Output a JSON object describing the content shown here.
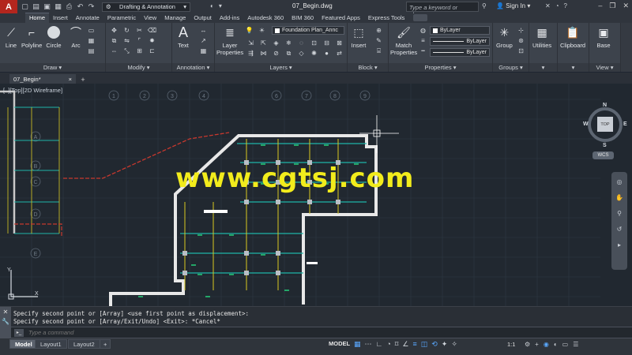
{
  "app": {
    "logo": "A",
    "workspace": "Drafting & Annotation",
    "document_title": "07_Begin.dwg",
    "search_placeholder": "Type a keyword or phrase",
    "sign_in": "Sign In"
  },
  "ribbon_tabs": [
    "Home",
    "Insert",
    "Annotate",
    "Parametric",
    "View",
    "Manage",
    "Output",
    "Add-ins",
    "Autodesk 360",
    "BIM 360",
    "Featured Apps",
    "Express Tools"
  ],
  "ribbon": {
    "draw": {
      "title": "Draw",
      "line": "Line",
      "polyline": "Polyline",
      "circle": "Circle",
      "arc": "Arc"
    },
    "modify": {
      "title": "Modify"
    },
    "annotation": {
      "title": "Annotation",
      "text": "Text"
    },
    "layers": {
      "title": "Layers",
      "layer_properties_1": "Layer",
      "layer_properties_2": "Properties",
      "current_layer": "Foundation Plan_Annc"
    },
    "block": {
      "title": "Block",
      "insert": "Insert"
    },
    "properties": {
      "title": "Properties",
      "match_1": "Match",
      "match_2": "Properties",
      "color": "ByLayer",
      "linetype": "ByLayer",
      "lineweight": "ByLayer"
    },
    "groups": {
      "title": "Groups",
      "group": "Group"
    },
    "utilities": {
      "label": "Utilities"
    },
    "clipboard": {
      "label": "Clipboard"
    },
    "view": {
      "title": "View",
      "base": "Base"
    }
  },
  "file_tab": {
    "name": "07_Begin*",
    "close": "×",
    "add": "+"
  },
  "viewport_label": "[–][Top][2D Wireframe]",
  "watermark": "www.cgtsj.com",
  "grid_labels": {
    "columns": [
      "1",
      "2",
      "3",
      "4",
      "5",
      "6",
      "7",
      "8",
      "9"
    ],
    "rows": [
      "A",
      "B",
      "C",
      "D",
      "E"
    ]
  },
  "viewcube": {
    "n": "N",
    "s": "S",
    "e": "E",
    "w": "W",
    "top": "TOP",
    "wcs": "WCS"
  },
  "ucs": {
    "x": "X",
    "y": "Y"
  },
  "command": {
    "history_1": "Specify second point or [Array] <use first point as displacement>:",
    "history_2": "Specify second point or [Array/Exit/Undo] <Exit>: *Cancel*",
    "input_placeholder": "Type a command"
  },
  "layout_tabs": [
    "Model",
    "Layout1",
    "Layout2"
  ],
  "status": {
    "model": "MODEL",
    "scale": "1:1"
  },
  "colors": {
    "accent_red": "#b3261e",
    "wall": "#e8e8e8",
    "cyan": "#1fb5a8",
    "yellow": "#d9c821",
    "watermark": "#f2ec1c"
  }
}
